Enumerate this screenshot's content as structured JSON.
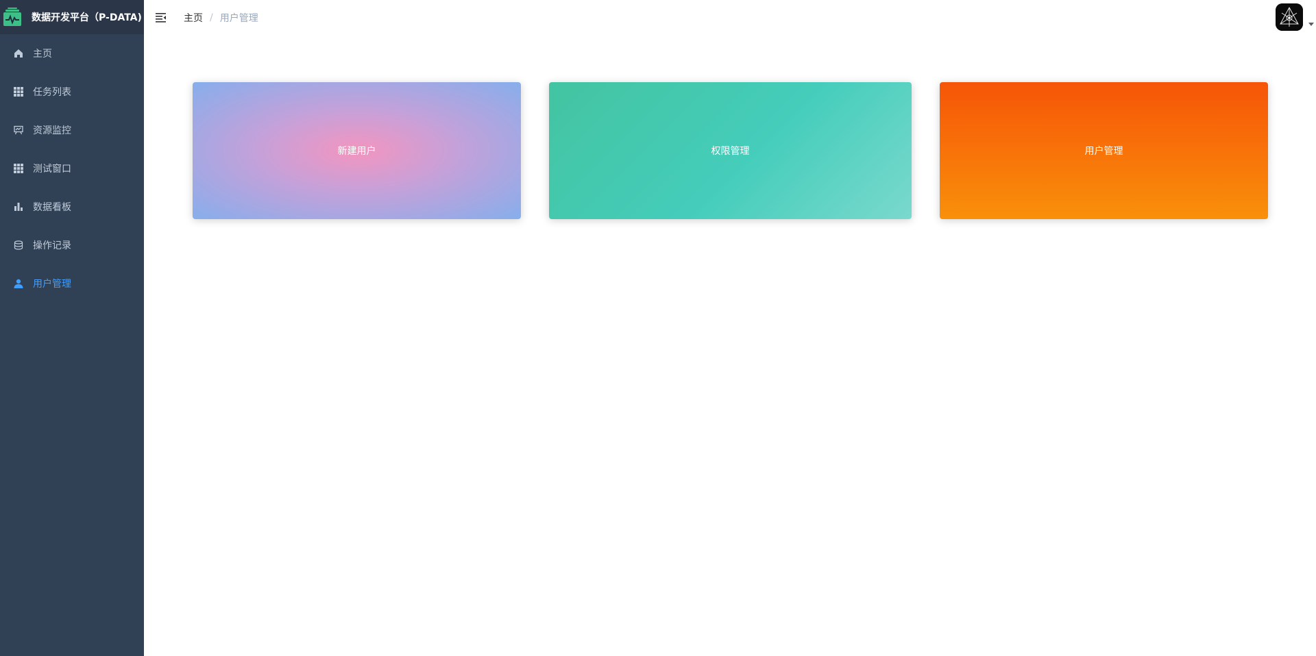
{
  "app": {
    "title": "数据开发平台（P-DATA)"
  },
  "sidebar": {
    "items": [
      {
        "label": "主页",
        "icon": "home-icon",
        "active": false
      },
      {
        "label": "任务列表",
        "icon": "grid-icon",
        "active": false
      },
      {
        "label": "资源监控",
        "icon": "presentation-icon",
        "active": false
      },
      {
        "label": "测试窗口",
        "icon": "grid-icon",
        "active": false
      },
      {
        "label": "数据看板",
        "icon": "bar-chart-icon",
        "active": false
      },
      {
        "label": "操作记录",
        "icon": "database-icon",
        "active": false
      },
      {
        "label": "用户管理",
        "icon": "user-icon",
        "active": true
      }
    ]
  },
  "breadcrumb": {
    "home": "主页",
    "separator": "/",
    "current": "用户管理"
  },
  "cards": [
    {
      "label": "新建用户"
    },
    {
      "label": "权限管理"
    },
    {
      "label": "用户管理"
    }
  ],
  "colors": {
    "sidebar_bg": "#304156",
    "logo_bg": "#2b3649",
    "menu_text": "#bfcbd9",
    "active_text": "#409eff",
    "logo_green": "#3fbf88"
  }
}
